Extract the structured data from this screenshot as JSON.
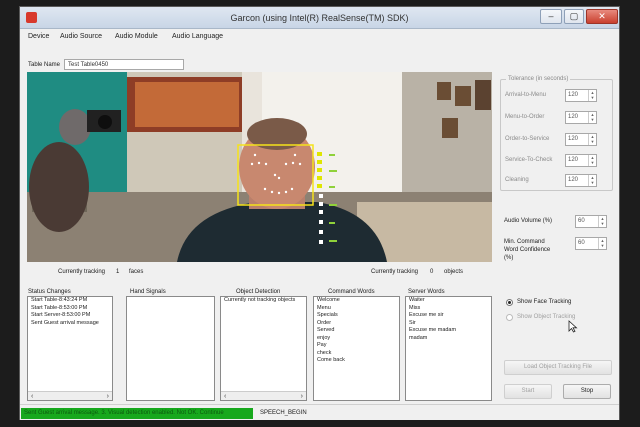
{
  "window": {
    "title": "Garcon (using Intel(R) RealSense(TM) SDK)",
    "controls": {
      "minimize": "–",
      "maximize": "▢",
      "close": "✕"
    }
  },
  "menu": [
    "Device",
    "Audio Source",
    "Audio Module",
    "Audio Language"
  ],
  "table": {
    "label": "Table Name",
    "value": "Test Table0450"
  },
  "video": {
    "face_box_color": "#f5e21b",
    "tracking_faces_label": "Currently tracking",
    "tracking_faces_count": "1",
    "tracking_faces_unit": "faces",
    "tracking_objects_label": "Currently tracking",
    "tracking_objects_count": "0",
    "tracking_objects_unit": "objects"
  },
  "status_changes": {
    "label": "Status Changes",
    "items": [
      "Start Table-8:43:24 PM",
      "Start Table-8:53:00 PM",
      "Start Server-8:53:00 PM",
      "Sent Guest arrival message"
    ]
  },
  "hand_signals": {
    "label": "Hand Signals",
    "items": []
  },
  "object_detection": {
    "label": "Object Detection",
    "items": [
      "Currently not tracking objects"
    ]
  },
  "command_words": {
    "label": "Command Words",
    "items": [
      "Welcome",
      "Menu",
      "Specials",
      "Order",
      "Served",
      "enjoy",
      "Pay",
      "check",
      "Come back"
    ]
  },
  "server_words": {
    "label": "Server Words",
    "items": [
      "Waiter",
      "Miss",
      "Excuse me sir",
      "Sir",
      "Excuse me madam",
      "madam"
    ]
  },
  "tolerance": {
    "legend": "Tolerance (in seconds)",
    "rows": [
      {
        "label": "Arrival-to-Menu",
        "value": "120"
      },
      {
        "label": "Menu-to-Order",
        "value": "120"
      },
      {
        "label": "Order-to-Service",
        "value": "120"
      },
      {
        "label": "Service-To-Check",
        "value": "120"
      },
      {
        "label": "Cleaning",
        "value": "120"
      }
    ]
  },
  "audio": {
    "volume_label": "Audio Volume (%)",
    "volume_value": "60",
    "confidence_label_1": "Min. Command",
    "confidence_label_2": "Word Confidence",
    "confidence_label_3": "(%)",
    "confidence_value": "60"
  },
  "tracking_options": {
    "face": "Show Face Tracking",
    "object": "Show Object Tracking",
    "face_selected": true
  },
  "buttons": {
    "load": "Load Object Tracking File",
    "start": "Start",
    "stop": "Stop"
  },
  "statusbar": {
    "message": "Sent Guest arrival message. 3. Visual detection enabled. Not OK. Continue",
    "state": "SPEECH_BEGIN",
    "message_color": "#17a81d"
  }
}
